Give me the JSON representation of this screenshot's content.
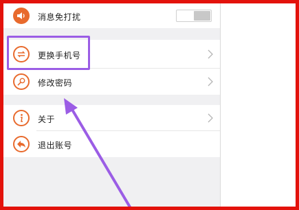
{
  "settings": {
    "items": [
      {
        "label": "消息免打扰",
        "icon": "speaker-icon",
        "control": "toggle",
        "toggle_on": false
      },
      {
        "label": "更换手机号",
        "icon": "swap-arrows-icon",
        "control": "chevron"
      },
      {
        "label": "修改密码",
        "icon": "key-icon",
        "control": "chevron"
      },
      {
        "label": "关于",
        "icon": "info-icon",
        "control": "chevron"
      },
      {
        "label": "退出账号",
        "icon": "back-arrow-icon",
        "control": "none"
      }
    ]
  },
  "colors": {
    "accent": "#e86a2d",
    "annotation": "#9b5de5",
    "frame": "#e3120b"
  }
}
